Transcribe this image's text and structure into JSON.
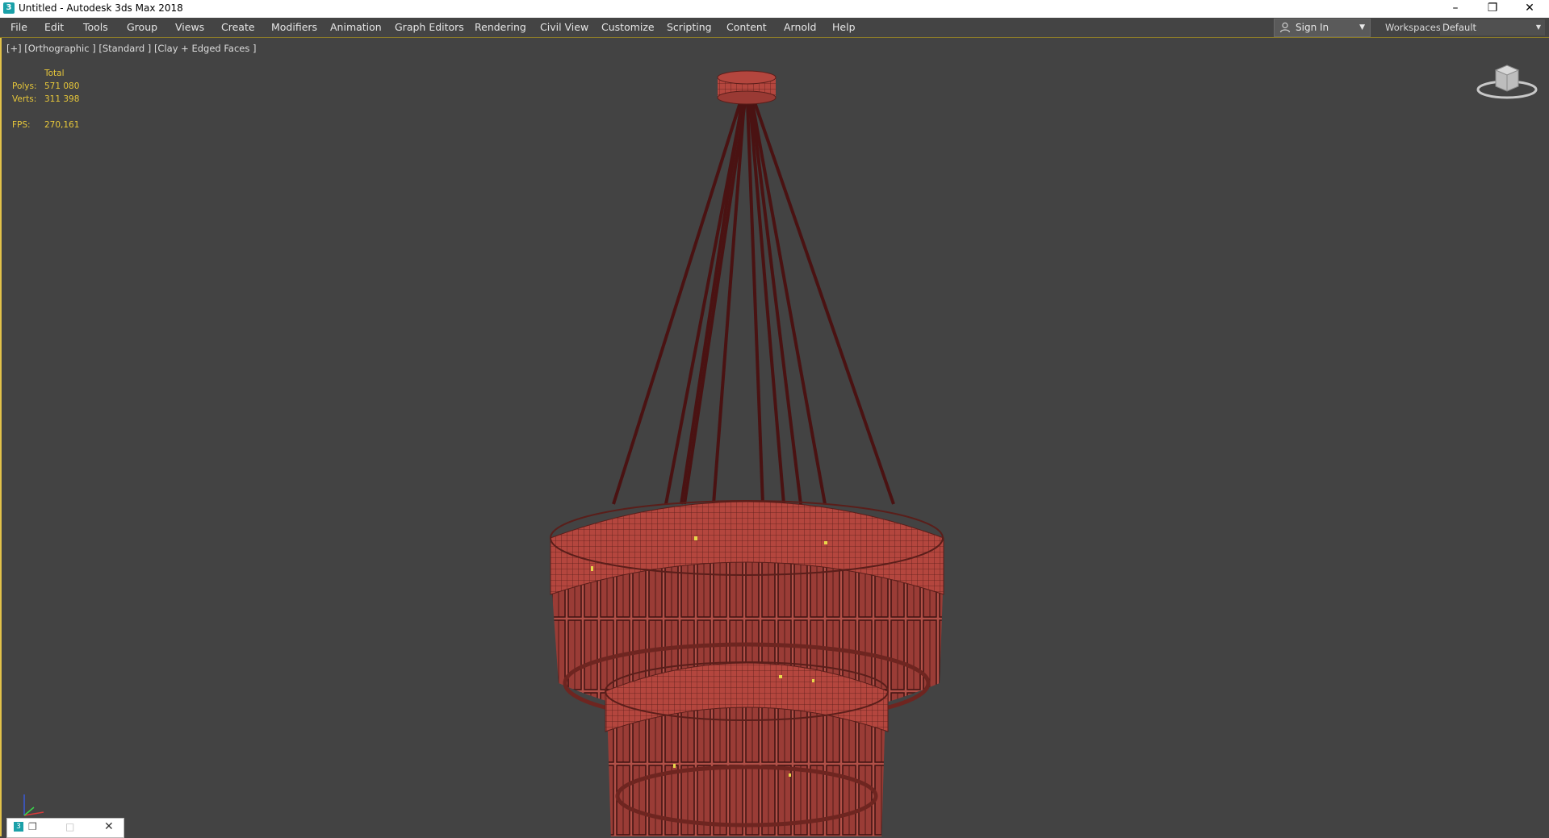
{
  "window": {
    "title": "Untitled - Autodesk 3ds Max 2018",
    "app_icon": "3"
  },
  "menu": [
    "File",
    "Edit",
    "Tools",
    "Group",
    "Views",
    "Create",
    "Modifiers",
    "Animation",
    "Graph Editors",
    "Rendering",
    "Civil View",
    "Customize",
    "Scripting",
    "Content",
    "Arnold",
    "Help"
  ],
  "account": {
    "sign_in_label": "Sign In"
  },
  "workspaces": {
    "label": "Workspaces:",
    "value": "Default"
  },
  "viewport": {
    "label": "[+] [Orthographic ] [Standard ] [Clay + Edged Faces ]",
    "stats": {
      "header": "Total",
      "polys_label": "Polys:",
      "polys_value": "571 080",
      "verts_label": "Verts:",
      "verts_value": "311 398",
      "fps_label": "FPS:",
      "fps_value": "270,161"
    },
    "active_border_color": "#e2c24a",
    "model_color": "#b4463e",
    "wire_color": "#4a1212"
  },
  "minimized_window": {
    "icon": "3"
  }
}
